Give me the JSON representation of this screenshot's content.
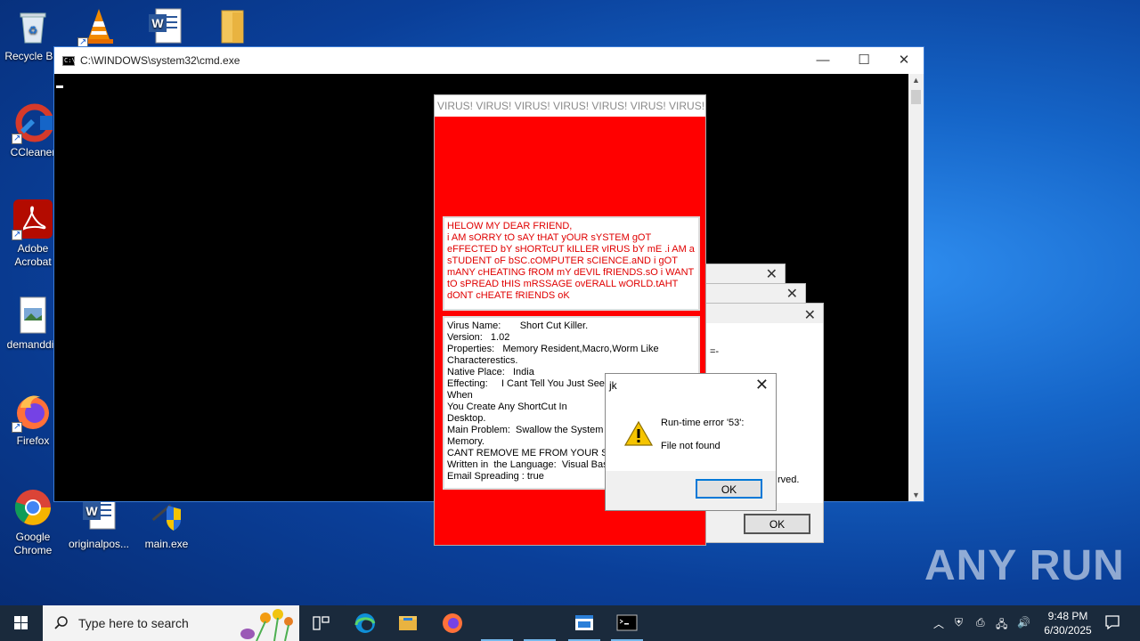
{
  "desktop": {
    "icons": [
      {
        "label": "Recycle Bin"
      },
      {
        "label": ""
      },
      {
        "label": ""
      },
      {
        "label": ""
      },
      {
        "label": "CCleaner"
      },
      {
        "label": "Adobe Acrobat"
      },
      {
        "label": "demanddis"
      },
      {
        "label": "Firefox"
      },
      {
        "label": "Google Chrome"
      },
      {
        "label": "originalpos..."
      },
      {
        "label": "main.exe"
      }
    ]
  },
  "cmd": {
    "title": "C:\\WINDOWS\\system32\\cmd.exe"
  },
  "virus_window": {
    "title": "VIRUS! VIRUS! VIRUS! VIRUS! VIRUS! VIRUS! VIRUS!",
    "message": "HELOW MY DEAR FRIEND,\ni AM sORRY tO sAY tHAT yOUR sYSTEM gOT eFFECTED bY sHORTcUT kILLER vIRUS bY mE .i AM a sTUDENT oF bSC.cOMPUTER sCIENCE.aND i gOT mANY cHEATING fROM mY dEVIL fRIENDS.sO i WANT tO sPREAD tHIS mRSSAGE ovERALL wORLD.tAHT dONT cHEATE fRIENDS oK",
    "info": [
      "Virus Name:       Short Cut Killer.",
      "Version:   1.02",
      "Properties:   Memory Resident,Macro,Worm Like",
      "Characterestics.",
      "Native Place:   India",
      "Effecting:     I Cant Tell You Just See It",
      "When",
      "You Create Any ShortCut In",
      "Desktop.",
      "Main Problem:  Swallow the System Co",
      "Memory.",
      "CANT REMOVE ME FROM YOUR SY",
      "Written in  the Language:  Visual Basic",
      "Email Spreading : true"
    ]
  },
  "behind_dialogs": {
    "text_fragment_1": "=-",
    "text_fragment_2": "rved.",
    "ok_label": "OK"
  },
  "error_dialog": {
    "title": "jk",
    "line1": "Run-time error '53':",
    "line2": "File not found",
    "ok_label": "OK"
  },
  "taskbar": {
    "search_placeholder": "Type here to search",
    "time": "9:48 PM",
    "date": "6/30/2025"
  },
  "watermark": "ANY RUN"
}
